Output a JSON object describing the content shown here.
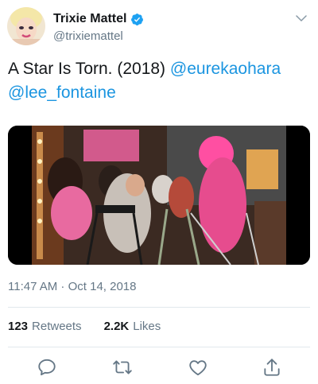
{
  "author": {
    "name": "Trixie Mattel",
    "handle": "@trixiemattel"
  },
  "tweet": {
    "text": "A Star Is Torn. (2018)",
    "mentions": [
      "@eurekaohara",
      "@lee_fontaine"
    ],
    "timestamp": "11:47 AM · Oct 14, 2018"
  },
  "stats": {
    "retweets_count": "123",
    "retweets_label": "Retweets",
    "likes_count": "2.2K",
    "likes_label": "Likes"
  },
  "icons": {
    "verified": "verified-badge-icon",
    "more": "chevron-down-icon",
    "reply": "comment-icon",
    "retweet": "retweet-icon",
    "like": "heart-icon",
    "share": "share-icon"
  },
  "colors": {
    "accent": "#1b95e0",
    "secondary_text": "#657786",
    "divider": "#e1e8ed"
  }
}
